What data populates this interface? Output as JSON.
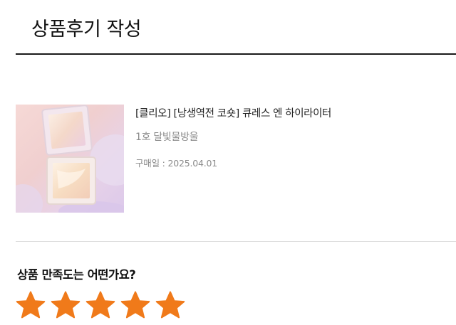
{
  "header": {
    "title": "상품후기 작성"
  },
  "product": {
    "name": "[클리오] [낭생역전 코숏] 큐레스 엔 하이라이터",
    "option": "1호 달빛물방울",
    "purchase_date": "구매일 : 2025.04.01",
    "image_icon": "product-photo"
  },
  "rating": {
    "question": "상품 만족도는 어떤가요?",
    "selected": 5,
    "max": 5,
    "star_color": "#f07a1a"
  }
}
